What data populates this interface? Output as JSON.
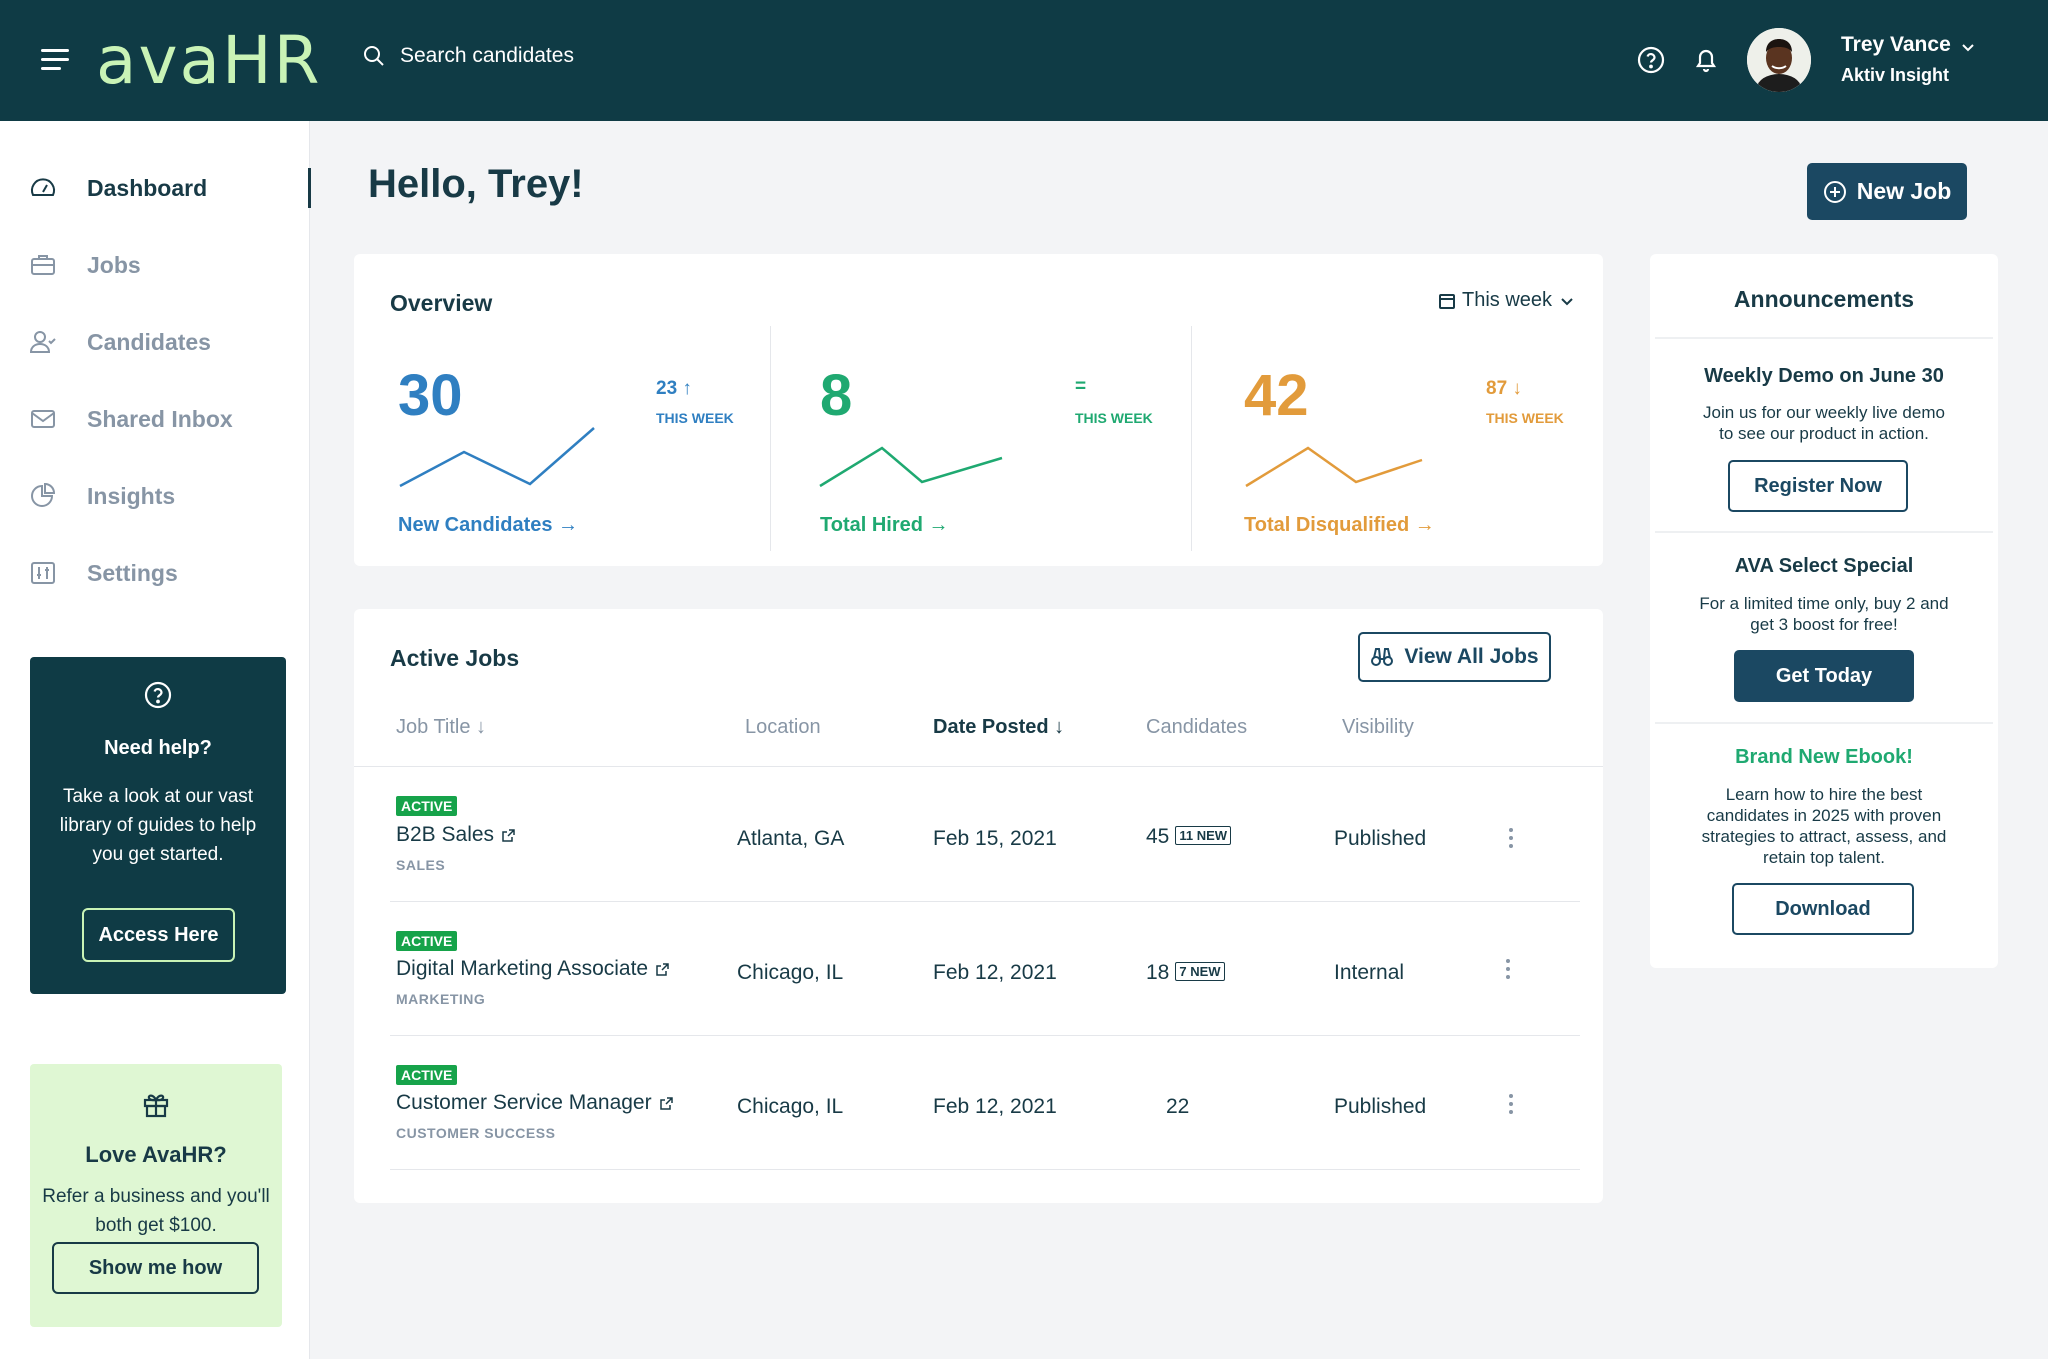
{
  "header": {
    "logo": "avaHR",
    "search_placeholder": "Search candidates",
    "user_name": "Trey Vance",
    "user_org": "Aktiv Insight"
  },
  "sidebar": {
    "items": [
      {
        "label": "Dashboard",
        "icon": "gauge-icon",
        "active": true
      },
      {
        "label": "Jobs",
        "icon": "briefcase-icon"
      },
      {
        "label": "Candidates",
        "icon": "user-check-icon"
      },
      {
        "label": "Shared Inbox",
        "icon": "mail-icon"
      },
      {
        "label": "Insights",
        "icon": "pie-chart-icon"
      },
      {
        "label": "Settings",
        "icon": "sliders-icon"
      }
    ],
    "help": {
      "title": "Need help?",
      "text": "Take a look at our vast library of guides to help you get started.",
      "button": "Access Here"
    },
    "love": {
      "title": "Love AvaHR?",
      "text": "Refer a business and you'll both get $100.",
      "button": "Show me how"
    }
  },
  "main": {
    "greeting": "Hello, Trey!",
    "new_job_label": "New Job",
    "overview": {
      "title": "Overview",
      "period": "This week",
      "stats": [
        {
          "value": "30",
          "delta": "23",
          "delta_dir": "up",
          "week_label": "THIS WEEK",
          "link": "New Candidates",
          "color": "#2f7fc1"
        },
        {
          "value": "8",
          "delta": "=",
          "delta_dir": "flat",
          "week_label": "THIS WEEK",
          "link": "Total Hired",
          "color": "#1fa971"
        },
        {
          "value": "42",
          "delta": "87",
          "delta_dir": "down",
          "week_label": "THIS WEEK",
          "link": "Total Disqualified",
          "color": "#e29b3b"
        }
      ]
    },
    "active_jobs": {
      "title": "Active Jobs",
      "view_all_label": "View All Jobs",
      "columns": [
        "Job Title",
        "Location",
        "Date Posted",
        "Candidates",
        "Visibility"
      ],
      "rows": [
        {
          "status": "ACTIVE",
          "title": "B2B Sales",
          "dept": "SALES",
          "location": "Atlanta, GA",
          "date": "Feb 15, 2021",
          "candidates": "45",
          "new": "11 NEW",
          "visibility": "Published"
        },
        {
          "status": "ACTIVE",
          "title": "Digital Marketing Associate",
          "dept": "MARKETING",
          "location": "Chicago, IL",
          "date": "Feb 12, 2021",
          "candidates": "18",
          "new": "7 NEW",
          "visibility": "Internal"
        },
        {
          "status": "ACTIVE",
          "title": "Customer Service Manager",
          "dept": "CUSTOMER SUCCESS",
          "location": "Chicago, IL",
          "date": "Feb 12, 2021",
          "candidates": "22",
          "new": "",
          "visibility": "Published"
        }
      ]
    }
  },
  "announcements": {
    "title": "Announcements",
    "items": [
      {
        "title": "Weekly Demo on June 30",
        "text_1": "Join us for our weekly live demo",
        "text_2": "to see our product in action.",
        "button": "Register Now"
      },
      {
        "title": "AVA Select Special",
        "text_1": "For a limited time only, buy 2 and",
        "text_2": "get 3 boost for free!",
        "button": "Get Today"
      },
      {
        "title": "Brand New Ebook!",
        "text_1": "Learn how to hire the best",
        "text_2": "candidates in 2025 with proven",
        "text_3": "strategies to attract, assess, and",
        "text_4": "retain top talent.",
        "button": "Download"
      }
    ]
  },
  "colors": {
    "header_bg": "#0f3b45",
    "logo": "#c9f3b6",
    "primary": "#1b4862",
    "active_badge": "#16a34a",
    "ebook_title": "#1fa971"
  }
}
